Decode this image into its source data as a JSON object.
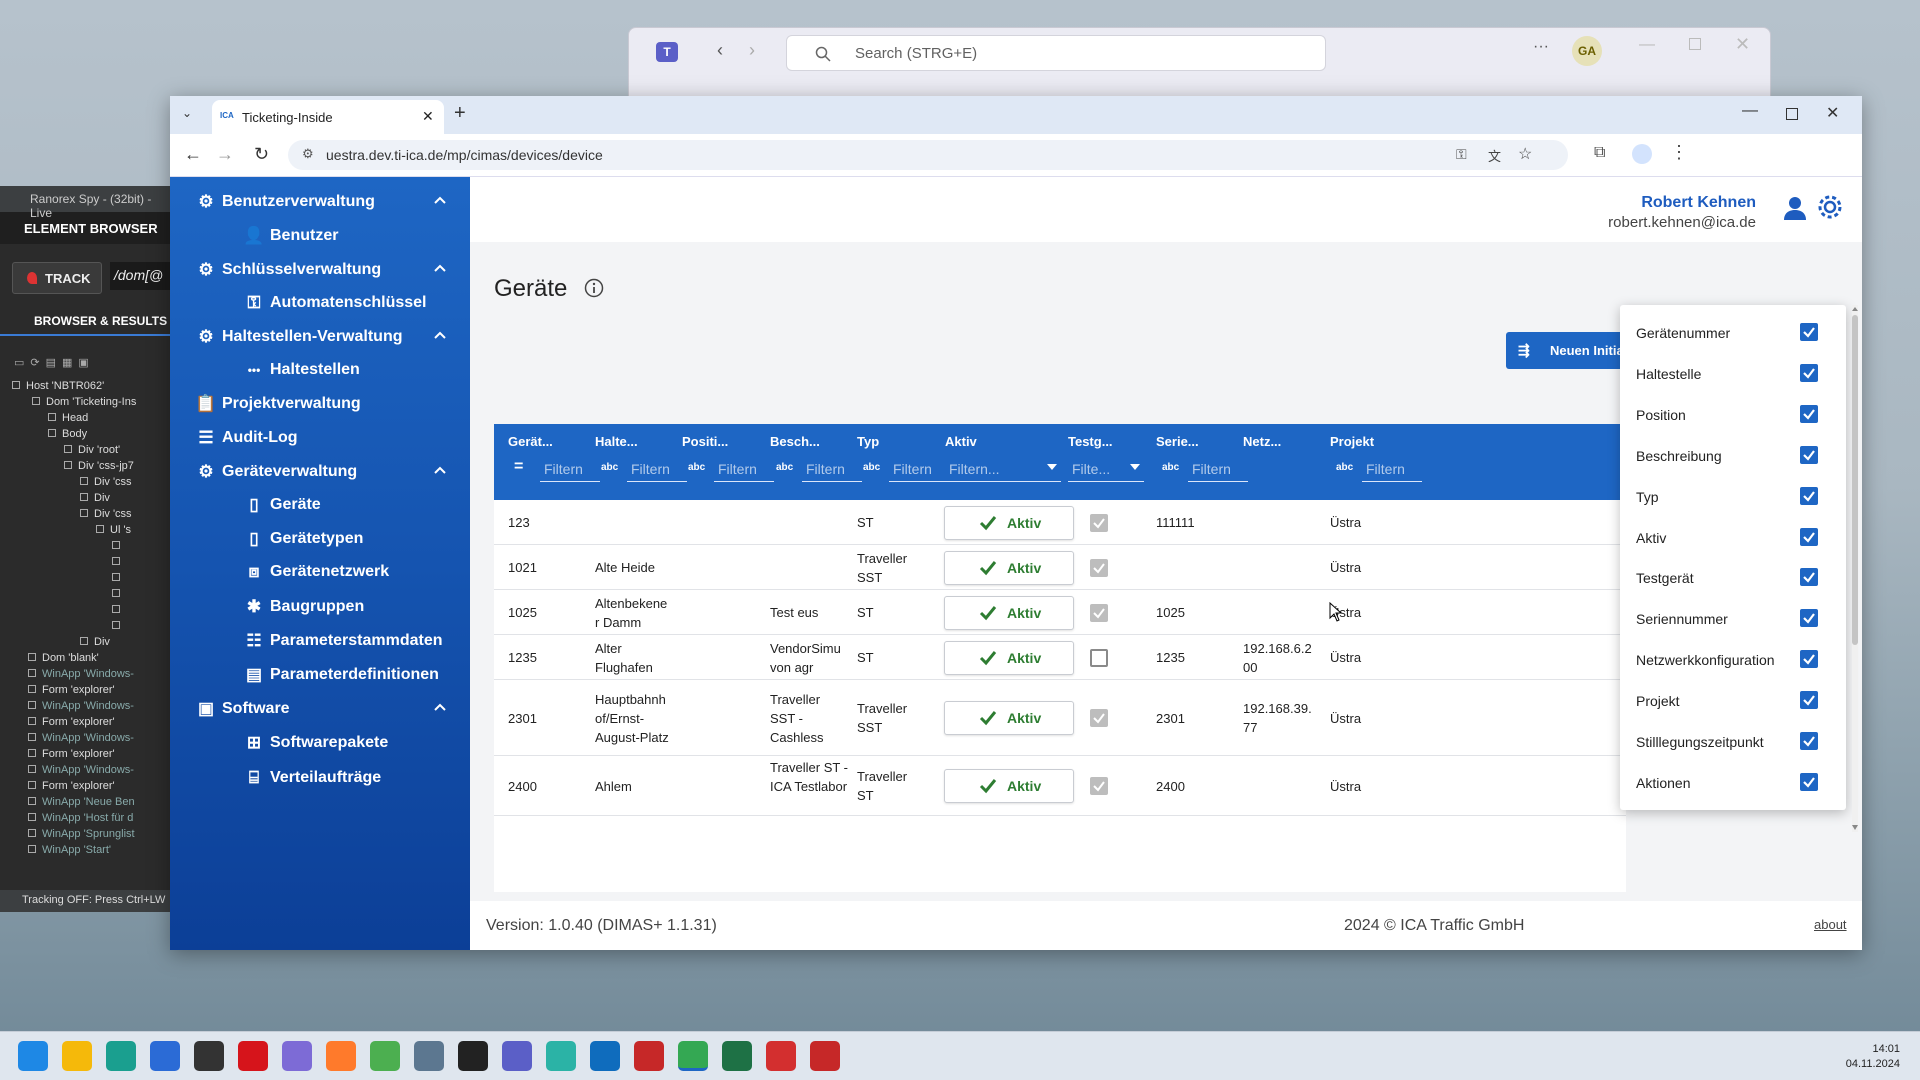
{
  "teams": {
    "search_placeholder": "Search (STRG+E)",
    "avatar": "GA"
  },
  "ranorex": {
    "title": "Ranorex Spy - (32bit) - Live",
    "element_browser": "ELEMENT BROWSER",
    "track": "TRACK",
    "path": "/dom[@",
    "browser_results": "BROWSER & RESULTS",
    "tree": [
      "Host 'NBTR062'",
      "Dom 'Ticketing-Ins",
      "Head",
      "Body",
      "Div 'root'",
      "Div 'css-jp7",
      "Div 'css",
      "Div",
      "Div 'css",
      "Ul 's",
      "",
      "",
      "",
      "",
      "",
      "",
      "Div",
      "Dom 'blank'",
      "WinApp 'Windows-",
      "Form 'explorer'",
      "WinApp 'Windows-",
      "Form 'explorer'",
      "WinApp 'Windows-",
      "Form 'explorer'",
      "WinApp 'Windows-",
      "Form 'explorer'",
      "WinApp 'Neue Ben",
      "WinApp 'Host für d",
      "WinApp 'Sprunglist",
      "WinApp 'Start'"
    ],
    "status": "Tracking OFF: Press Ctrl+LW"
  },
  "browser": {
    "tab_title": "Ticketing-Inside",
    "tab_favicon": "ICA",
    "url": "uestra.dev.ti-ica.de/mp/cimas/devices/device"
  },
  "sidebar": {
    "items": [
      {
        "label": "Benutzerverwaltung",
        "icon": "users-gear-icon",
        "level": 0,
        "expandable": true
      },
      {
        "label": "Benutzer",
        "icon": "user-icon",
        "level": 1
      },
      {
        "label": "Schlüsselverwaltung",
        "icon": "key-gear-icon",
        "level": 0,
        "expandable": true
      },
      {
        "label": "Automatenschlüssel",
        "icon": "key-icon",
        "level": 1
      },
      {
        "label": "Haltestellen-Verwaltung",
        "icon": "stops-gear-icon",
        "level": 0,
        "expandable": true
      },
      {
        "label": "Haltestellen",
        "icon": "dots-icon",
        "level": 1
      },
      {
        "label": "Projektverwaltung",
        "icon": "clipboard-icon",
        "level": 0
      },
      {
        "label": "Audit-Log",
        "icon": "list-icon",
        "level": 0
      },
      {
        "label": "Geräteverwaltung",
        "icon": "device-gear-icon",
        "level": 0,
        "expandable": true
      },
      {
        "label": "Geräte",
        "icon": "device-icon",
        "level": 1
      },
      {
        "label": "Gerätetypen",
        "icon": "device-types-icon",
        "level": 1
      },
      {
        "label": "Gerätenetzwerk",
        "icon": "network-icon",
        "level": 1
      },
      {
        "label": "Baugruppen",
        "icon": "puzzle-icon",
        "level": 1
      },
      {
        "label": "Parameterstammdaten",
        "icon": "table-list-icon",
        "level": 1
      },
      {
        "label": "Parameterdefinitionen",
        "icon": "doc-list-icon",
        "level": 1
      },
      {
        "label": "Software",
        "icon": "software-icon",
        "level": 0,
        "expandable": true
      },
      {
        "label": "Softwarepakete",
        "icon": "package-icon",
        "level": 1
      },
      {
        "label": "Verteilaufträge",
        "icon": "distribution-icon",
        "level": 1
      }
    ]
  },
  "header": {
    "user_name": "Robert Kehnen",
    "user_email": "robert.kehnen@ica.de"
  },
  "page": {
    "title": "Geräte",
    "new_button": "Neuen Initia"
  },
  "grid": {
    "columns": [
      {
        "label": "Gerät...",
        "filter": "Filtern",
        "filter_icon": "="
      },
      {
        "label": "Halte...",
        "filter": "Filtern",
        "filter_icon": "abc"
      },
      {
        "label": "Positi...",
        "filter": "Filtern",
        "filter_icon": "abc"
      },
      {
        "label": "Besch...",
        "filter": "Filtern",
        "filter_icon": "abc"
      },
      {
        "label": "Typ",
        "filter": "Filtern",
        "filter_icon": "abc"
      },
      {
        "label": "Aktiv",
        "filter": "Filtern...",
        "filter_icon": ""
      },
      {
        "label": "Testg...",
        "filter": "Filte...",
        "filter_icon": ""
      },
      {
        "label": "Serie...",
        "filter": "Filtern",
        "filter_icon": "abc"
      },
      {
        "label": "Netz...",
        "filter": "",
        "filter_icon": ""
      },
      {
        "label": "Projekt",
        "filter": "Filtern",
        "filter_icon": "abc"
      }
    ],
    "rows": [
      {
        "nr": "123",
        "halt": "",
        "pos": "",
        "besch": "",
        "typ": "ST",
        "aktiv": "Aktiv",
        "test": true,
        "serie": "111111",
        "netz": "",
        "projekt": "Üstra"
      },
      {
        "nr": "1021",
        "halt": "Alte Heide",
        "pos": "",
        "besch": "",
        "typ": "Traveller SST",
        "aktiv": "Aktiv",
        "test": true,
        "serie": "",
        "netz": "",
        "projekt": "Üstra"
      },
      {
        "nr": "1025",
        "halt": "Altenbekene r Damm",
        "pos": "",
        "besch": "Test eus",
        "typ": "ST",
        "aktiv": "Aktiv",
        "test": true,
        "serie": "1025",
        "netz": "",
        "projekt": "Üstra"
      },
      {
        "nr": "1235",
        "halt": "Alter Flughafen",
        "pos": "",
        "besch": "VendorSimu von agr",
        "typ": "ST",
        "aktiv": "Aktiv",
        "test": false,
        "serie": "1235",
        "netz": "192.168.6.2 00",
        "projekt": "Üstra"
      },
      {
        "nr": "2301",
        "halt": "Hauptbahnh of/Ernst-August-Platz",
        "pos": "",
        "besch": "Traveller SST - Cashless",
        "typ": "Traveller SST",
        "aktiv": "Aktiv",
        "test": true,
        "serie": "2301",
        "netz": "192.168.39. 77",
        "projekt": "Üstra"
      },
      {
        "nr": "2400",
        "halt": "Ahlem",
        "pos": "",
        "besch": "Traveller ST - ICA Testlabor",
        "typ": "Traveller ST",
        "aktiv": "Aktiv",
        "test": true,
        "serie": "2400",
        "netz": "",
        "projekt": "Üstra"
      }
    ]
  },
  "column_panel": {
    "items": [
      {
        "label": "Gerätenummer",
        "checked": true
      },
      {
        "label": "Haltestelle",
        "checked": true
      },
      {
        "label": "Position",
        "checked": true
      },
      {
        "label": "Beschreibung",
        "checked": true
      },
      {
        "label": "Typ",
        "checked": true
      },
      {
        "label": "Aktiv",
        "checked": true
      },
      {
        "label": "Testgerät",
        "checked": true
      },
      {
        "label": "Seriennummer",
        "checked": true
      },
      {
        "label": "Netzwerkkonfiguration",
        "checked": true
      },
      {
        "label": "Projekt",
        "checked": true
      },
      {
        "label": "Stilllegungszeitpunkt",
        "checked": true
      },
      {
        "label": "Aktionen",
        "checked": true
      }
    ]
  },
  "footer": {
    "version": "Version: 1.0.40 (DIMAS+ 1.1.31)",
    "copyright": "2024 © ICA Traffic GmbH",
    "about": "about"
  },
  "taskbar": {
    "time": "14:01",
    "date": "04.11.2024"
  },
  "colors": {
    "primary": "#1e66c4",
    "sidebar_dark": "#0c3f97",
    "aktiv_green": "#2e7d32"
  }
}
